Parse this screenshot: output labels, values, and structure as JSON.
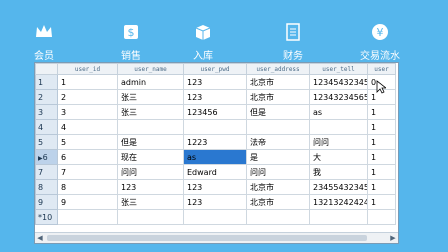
{
  "toolbar": {
    "items": [
      {
        "label": "会员",
        "icon": "crown-icon"
      },
      {
        "label": "销售",
        "icon": "money-icon"
      },
      {
        "label": "入库",
        "icon": "box-icon"
      },
      {
        "label": "财务",
        "icon": "ledger-icon"
      },
      {
        "label": "交易流水",
        "icon": "yen-icon"
      }
    ]
  },
  "table": {
    "columns": [
      "user_id",
      "user_name",
      "user_pwd",
      "user_address",
      "user_tell",
      "user"
    ],
    "rows": [
      {
        "rowhead": "1",
        "cells": [
          "1",
          "admin",
          "123",
          "北京市",
          "12345432345",
          "0"
        ]
      },
      {
        "rowhead": "2",
        "cells": [
          "2",
          "张三",
          "123",
          "北京市",
          "12343234565",
          "1"
        ]
      },
      {
        "rowhead": "3",
        "cells": [
          "3",
          "张三",
          "123456",
          "但是",
          "as",
          "1"
        ]
      },
      {
        "rowhead": "4",
        "cells": [
          "4",
          "",
          "",
          "",
          "",
          "1"
        ]
      },
      {
        "rowhead": "5",
        "cells": [
          "5",
          "但是",
          "1223",
          "法帝",
          "问问",
          "1"
        ]
      },
      {
        "rowhead": "6",
        "cells": [
          "6",
          "现在",
          "as",
          "是",
          "大",
          "1"
        ]
      },
      {
        "rowhead": "7",
        "cells": [
          "7",
          "问问",
          "Edward",
          "问问",
          "我",
          "1"
        ]
      },
      {
        "rowhead": "8",
        "cells": [
          "8",
          "123",
          "123",
          "北京市",
          "23455432345",
          "1"
        ]
      },
      {
        "rowhead": "9",
        "cells": [
          "9",
          "张三",
          "123",
          "北京市",
          "13213242424",
          "1"
        ]
      },
      {
        "rowhead": "*10",
        "cells": [
          "",
          "",
          "",
          "",
          "",
          ""
        ]
      }
    ],
    "selected_row_marker": "▶",
    "new_row_marker": "*"
  },
  "colors": {
    "background": "#55b6ec",
    "selection": "#2a78d0"
  }
}
